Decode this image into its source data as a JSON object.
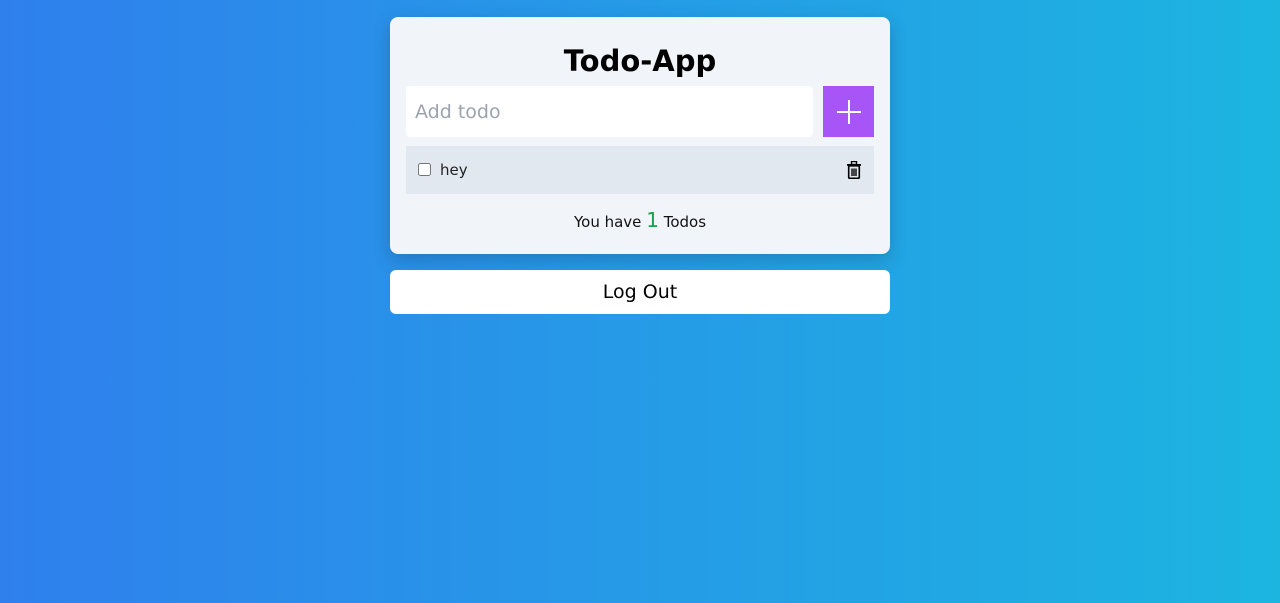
{
  "app": {
    "title": "Todo-App"
  },
  "input": {
    "placeholder": "Add todo",
    "value": ""
  },
  "add_button": {
    "icon": "plus-icon"
  },
  "todos": [
    {
      "text": "hey",
      "completed": false
    }
  ],
  "summary": {
    "prefix": "You have",
    "count": "1",
    "suffix": "Todos"
  },
  "logout": {
    "label": "Log Out"
  },
  "colors": {
    "background_start": "#2f80ed",
    "background_end": "#1cb5e0",
    "card": "#f1f4f9",
    "accent": "#a855f7",
    "count": "#16a34a",
    "todo_item": "#e2e8f0"
  }
}
